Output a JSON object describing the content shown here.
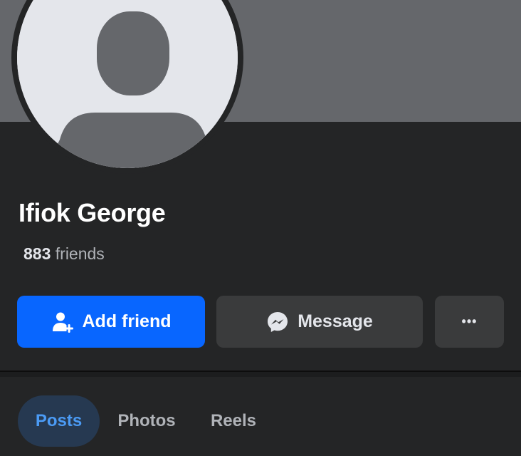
{
  "profile": {
    "name": "Ifiok George",
    "friends_count": "883",
    "friends_label": "friends"
  },
  "actions": {
    "add_friend_label": "Add friend",
    "message_label": "Message",
    "more_label": "•••"
  },
  "icons": {
    "add_friend": "add-friend-icon",
    "message": "messenger-icon",
    "avatar": "default-avatar-icon"
  },
  "tabs": [
    {
      "label": "Posts",
      "active": true
    },
    {
      "label": "Photos",
      "active": false
    },
    {
      "label": "Reels",
      "active": false
    }
  ],
  "colors": {
    "background": "#242526",
    "cover": "#65676b",
    "primary": "#0866ff",
    "active_tab_bg": "#263951",
    "active_tab_text": "#4b9bf5"
  }
}
